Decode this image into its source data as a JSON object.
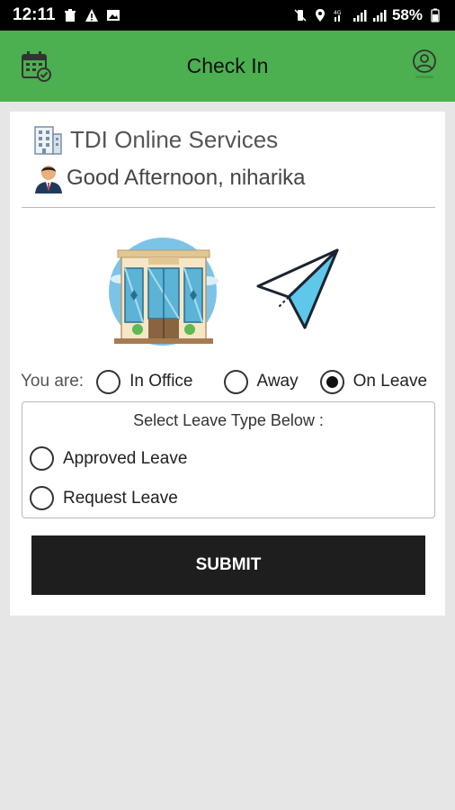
{
  "status_bar": {
    "time": "12:11",
    "battery": "58%"
  },
  "header": {
    "title": "Check In",
    "left_icon": "calendar-check-icon",
    "right_icon": "user-profile-icon",
    "bg_color": "#4caf50"
  },
  "company": {
    "name": "TDI Online Services",
    "icon": "building-icon"
  },
  "greeting": {
    "text": "Good Afternoon, niharika",
    "icon": "person-avatar-icon"
  },
  "status_options": {
    "label": "You are:",
    "options": [
      {
        "label": "In Office",
        "selected": false
      },
      {
        "label": "Away",
        "selected": false
      },
      {
        "label": "On Leave",
        "selected": true
      }
    ]
  },
  "leave": {
    "title": "Select Leave Type Below :",
    "options": [
      {
        "label": "Approved Leave",
        "selected": false
      },
      {
        "label": "Request Leave",
        "selected": false
      }
    ]
  },
  "submit_label": "SUBMIT"
}
